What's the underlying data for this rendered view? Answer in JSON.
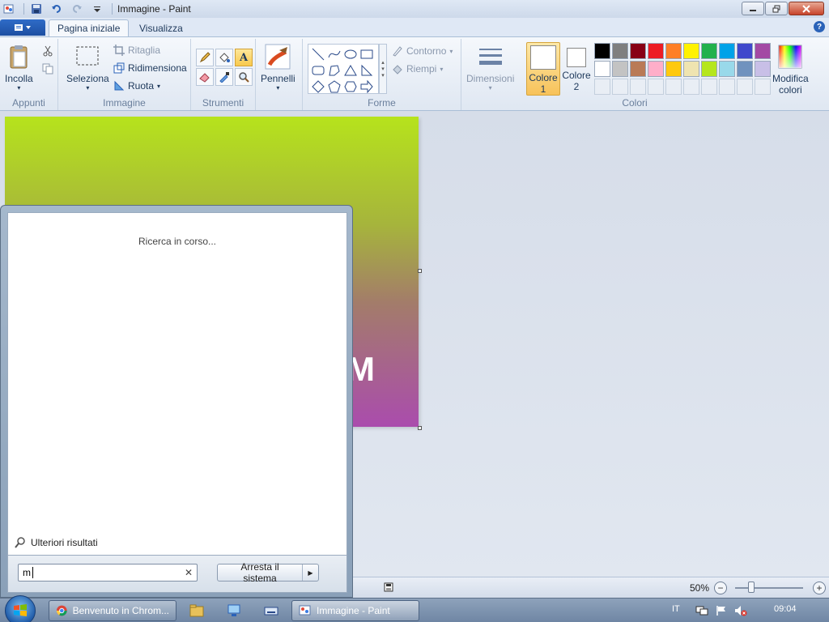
{
  "window": {
    "title": "Immagine - Paint"
  },
  "tabs": [
    "Pagina iniziale",
    "Visualizza"
  ],
  "ribbon": {
    "appunti": {
      "label": "Appunti",
      "paste": "Incolla"
    },
    "immagine": {
      "label": "Immagine",
      "select": "Seleziona",
      "crop": "Ritaglia",
      "resize": "Ridimensiona",
      "rotate": "Ruota"
    },
    "strumenti": {
      "label": "Strumenti"
    },
    "pennelli": {
      "label": "Pennelli"
    },
    "forme": {
      "label": "Forme",
      "outline": "Contorno",
      "fill": "Riempi"
    },
    "dimensioni": {
      "label": "Dimensioni"
    },
    "colori": {
      "label": "Colori",
      "color1": "Colore",
      "color1_num": "1",
      "color2": "Colore",
      "color2_num": "2",
      "edit": "Modifica",
      "edit2": "colori",
      "palette": [
        "#000000",
        "#7f7f7f",
        "#880015",
        "#ed1c24",
        "#ff7f27",
        "#fff200",
        "#22b14c",
        "#00a2e8",
        "#3f48cc",
        "#a349a4",
        "#ffffff",
        "#c3c3c3",
        "#b97a57",
        "#ffaec9",
        "#ffc90e",
        "#efe4b0",
        "#b5e61d",
        "#99d9ea",
        "#7092be",
        "#c8bfe7"
      ]
    }
  },
  "canvas": {
    "visible_letter": "M"
  },
  "status": {
    "zoom": "50%"
  },
  "startmenu": {
    "searching": "Ricerca in corso...",
    "more_results": "Ulteriori risultati",
    "search_value": "m",
    "shutdown": "Arresta il sistema"
  },
  "taskbar": {
    "chrome": "Benvenuto in Chrom...",
    "paint": "Immagine - Paint",
    "lang": "IT",
    "time": "09:04"
  }
}
